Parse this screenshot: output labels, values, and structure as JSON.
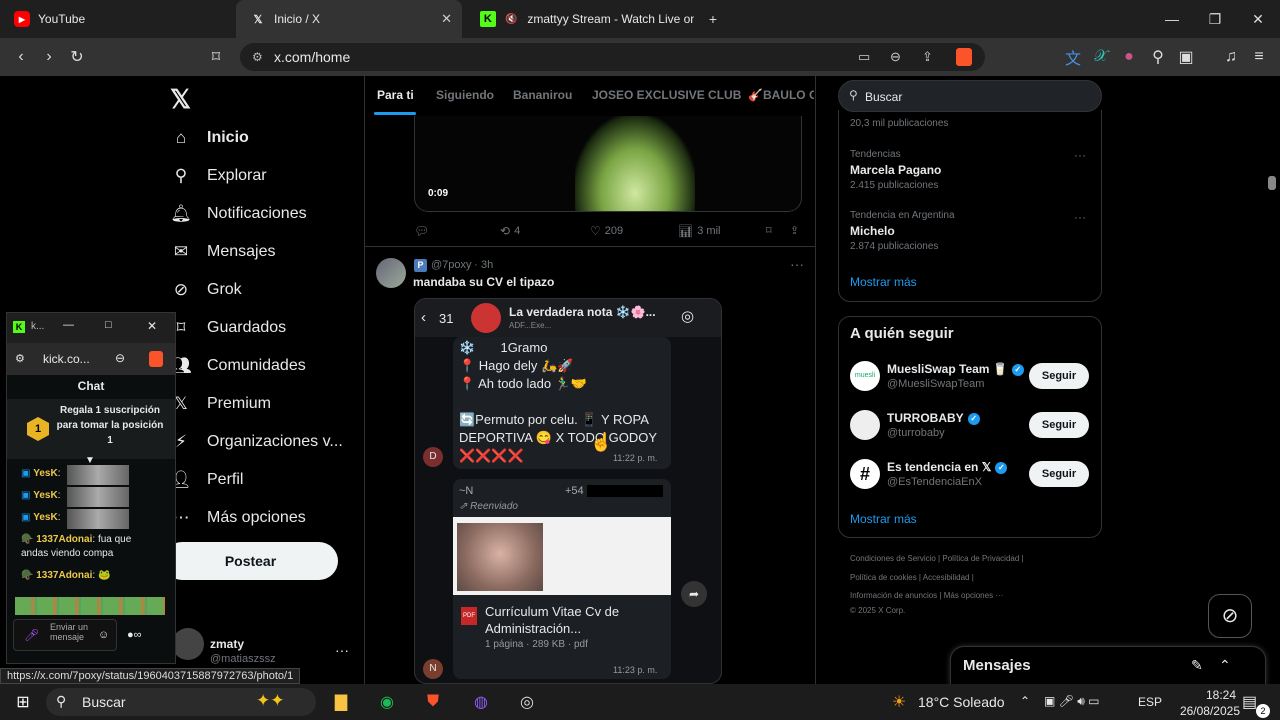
{
  "browser": {
    "tabs": [
      {
        "title": "YouTube"
      },
      {
        "title": "Inicio / X"
      },
      {
        "title": "zmattyy Stream - Watch Live on K"
      }
    ],
    "url": "x.com/home",
    "status_url": "https://x.com/7poxy/status/1960403715887972763/photo/1"
  },
  "sidebar": {
    "items": [
      {
        "label": "Inicio",
        "icon": "home-icon"
      },
      {
        "label": "Explorar",
        "icon": "search-icon"
      },
      {
        "label": "Notificaciones",
        "icon": "bell-icon"
      },
      {
        "label": "Mensajes",
        "icon": "mail-icon"
      },
      {
        "label": "Grok",
        "icon": "grok-icon"
      },
      {
        "label": "Guardados",
        "icon": "bookmark-icon"
      },
      {
        "label": "Comunidades",
        "icon": "people-icon"
      },
      {
        "label": "Premium",
        "icon": "x-icon"
      },
      {
        "label": "Organizaciones v...",
        "icon": "lightning-icon"
      },
      {
        "label": "Perfil",
        "icon": "person-icon"
      },
      {
        "label": "Más opciones",
        "icon": "more-icon"
      }
    ],
    "post_label": "Postear",
    "account_name": "zmaty",
    "account_handle": "@matiaszssz"
  },
  "feed": {
    "tabs": [
      "Para ti",
      "Siguiendo",
      "Bananirou",
      "JOSEO EXCLUSIVE CLUB",
      "🎸BAULO CL"
    ],
    "video_time": "0:09",
    "actions": {
      "retweets": "4",
      "likes": "209",
      "views": "3 mil"
    },
    "post": {
      "handle": "@7poxy",
      "time": "3h",
      "text": "mandaba su CV el tipazo",
      "chat_back": "31",
      "chat_title": "La verdadera nota ❄️🌸...",
      "chat_sub": "ADF...Exe...",
      "msg1_lines": [
        "❄️       1Gramo",
        "📍 Hago dely 🛵🚀",
        "📍 Ah todo lado 🏃‍♂️🤝",
        "",
        "🔄Permuto por celu. 📱 Y ROPA",
        "DEPORTIVA 😋 X TODO GODOY",
        "❌❌❌❌"
      ],
      "msg1_time": "11:22 p. m.",
      "avatar1": "D",
      "fwd_name": "~N",
      "fwd_phone": "+54",
      "fwd_label": "Reenviado",
      "doc_title": "Currículum Vitae Cv de Administración...",
      "doc_meta": "1 página · 289 KB · pdf",
      "doc_badge": "PDF",
      "msg2_time": "11:23 p. m.",
      "avatar2": "N"
    }
  },
  "right": {
    "search_placeholder": "Buscar",
    "trend0_count": "20,3 mil publicaciones",
    "trends": [
      {
        "context": "Tendencias",
        "title": "Marcela Pagano",
        "count": "2.415 publicaciones"
      },
      {
        "context": "Tendencia en Argentina",
        "title": "Michelo",
        "count": "2.874 publicaciones"
      }
    ],
    "show_more": "Mostrar más",
    "who_to_follow": "A quién seguir",
    "follow": [
      {
        "name": "MuesliSwap Team 🥛",
        "handle": "@MuesliSwapTeam",
        "btn": "Seguir"
      },
      {
        "name": "TURROBABY",
        "handle": "@turrobaby",
        "btn": "Seguir"
      },
      {
        "name": "Es tendencia en 𝕏",
        "handle": "@EsTendenciaEnX",
        "btn": "Seguir"
      }
    ],
    "footer": [
      "Condiciones de Servicio",
      "Política de Privacidad",
      "Política de cookies",
      "Accesibilidad",
      "Información de anuncios",
      "Más opciones ···",
      "© 2025 X Corp."
    ],
    "messages_label": "Mensajes"
  },
  "kick": {
    "url": "kick.co...",
    "chat_title": "Chat",
    "sub_banner": "Regala 1 suscripción para tomar la posición 1",
    "sub_number": "1",
    "messages": [
      {
        "user": "YesK",
        "text": ""
      },
      {
        "user": "YesK",
        "text": ""
      },
      {
        "user": "YesK",
        "text": ""
      },
      {
        "user": "1337Adonai",
        "text": "fua que andas viendo compa"
      },
      {
        "user": "1337Adonai",
        "text": ""
      }
    ],
    "input_placeholder": "Enviar un mensaje"
  },
  "taskbar": {
    "search": "Buscar",
    "weather": "18°C  Soleado",
    "lang": "ESP",
    "time": "18:24",
    "date": "26/08/2025",
    "notif": "2"
  }
}
